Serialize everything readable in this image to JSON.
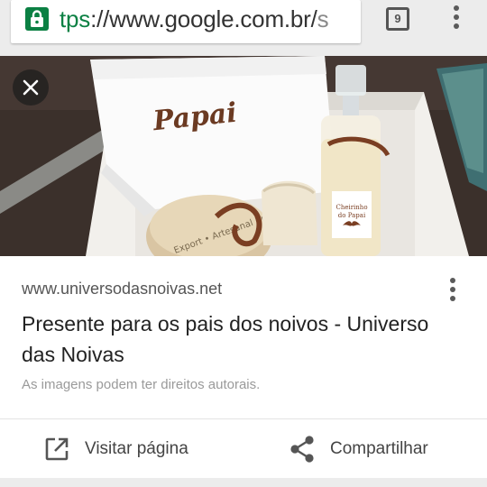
{
  "browser": {
    "url_scheme_fragment": "tps",
    "url_host": "://www.google.com.br/",
    "url_tail": "s",
    "tab_count": "9"
  },
  "hero": {
    "towel_text": "Papai",
    "bottle_label_line1": "Cheirinho",
    "bottle_label_line2": "do Papai",
    "jar_text": "Export • Artesanal Bra"
  },
  "result": {
    "source": "www.universodasnoivas.net",
    "title": "Presente para os pais dos noivos - Universo das Noivas",
    "rights_note": "As imagens podem ter direitos autorais."
  },
  "actions": {
    "visit_label": "Visitar página",
    "share_label": "Compartilhar"
  },
  "colors": {
    "secure_green": "#0b8043",
    "text_dark": "#222222",
    "text_muted": "#9a9a9a"
  }
}
